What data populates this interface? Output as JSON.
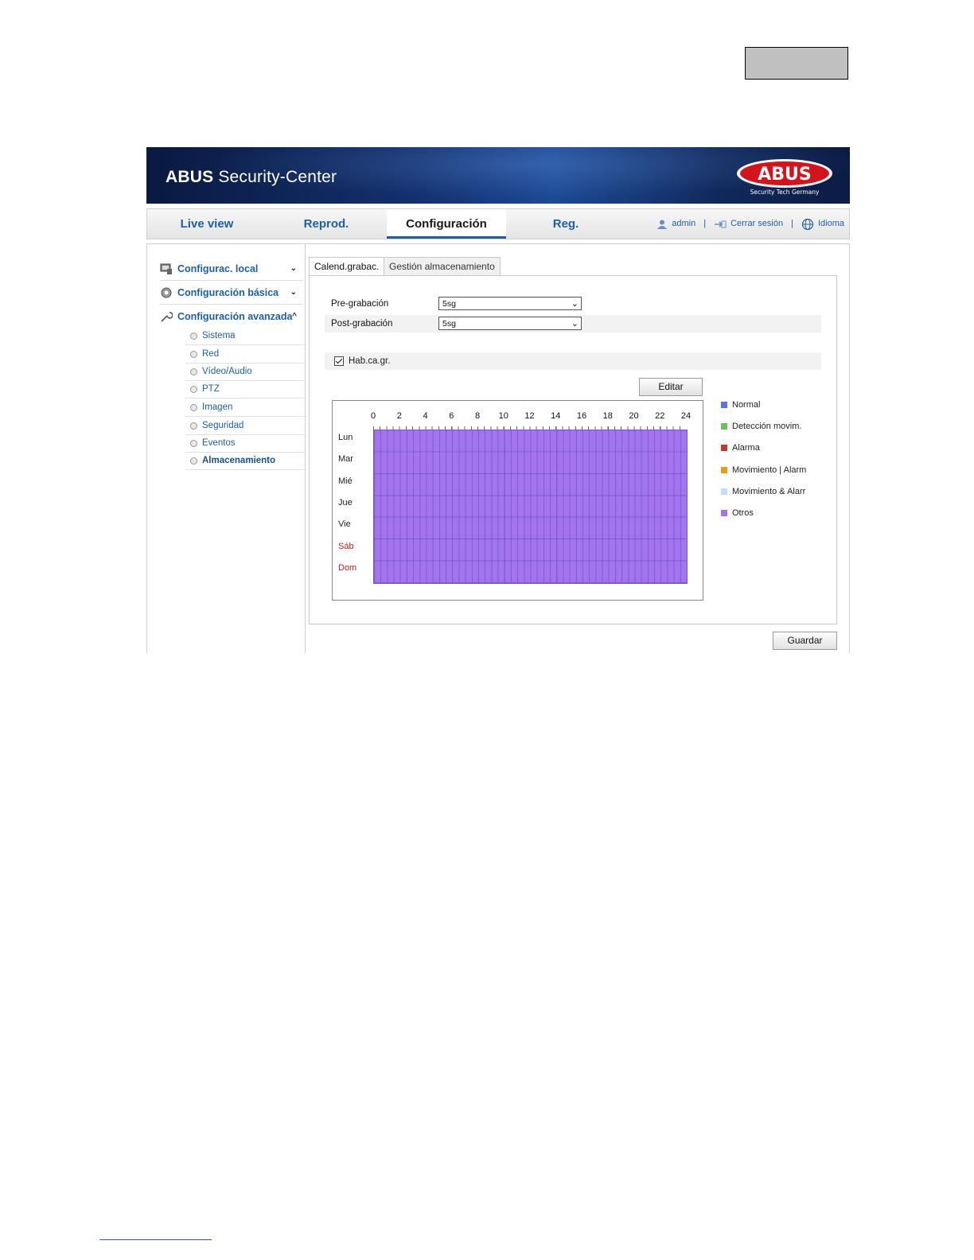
{
  "header": {
    "app_title_bold": "ABUS",
    "app_title_rest": " Security-Center",
    "logo_text": "ABUS",
    "logo_tagline": "Security Tech Germany"
  },
  "topnav": {
    "tabs": [
      {
        "label": "Live view",
        "active": false
      },
      {
        "label": "Reprod.",
        "active": false
      },
      {
        "label": "Configuración",
        "active": true
      },
      {
        "label": "Reg.",
        "active": false
      }
    ],
    "user": "admin",
    "logout": "Cerrar sesión",
    "language": "Idioma"
  },
  "sidebar": {
    "sections": [
      {
        "label": "Configurac. local",
        "icon": "monitor-icon",
        "chevron": "⌄"
      },
      {
        "label": "Configuración básica",
        "icon": "gear-icon",
        "chevron": "⌄"
      },
      {
        "label": "Configuración avanzada",
        "icon": "wrench-icon",
        "chevron": "^"
      }
    ],
    "items": [
      "Sistema",
      "Red",
      "Vídeo/Audio",
      "PTZ",
      "Imagen",
      "Seguridad",
      "Eventos",
      "Almacenamiento"
    ],
    "active_item": "Almacenamiento"
  },
  "subtabs": [
    "Calend.grabac.",
    "Gestión almacenamiento"
  ],
  "form": {
    "pre_label": "Pre-grabación",
    "pre_value": "5sg",
    "post_label": "Post-grabación",
    "post_value": "5sg",
    "enable_label": "Hab.ca.gr.",
    "enable_checked": true
  },
  "buttons": {
    "edit": "Editar",
    "save": "Guardar"
  },
  "schedule": {
    "hours": [
      "0",
      "2",
      "4",
      "6",
      "8",
      "10",
      "12",
      "14",
      "16",
      "18",
      "20",
      "22",
      "24"
    ],
    "days": [
      "Lun",
      "Mar",
      "Mié",
      "Jue",
      "Vie",
      "Sáb",
      "Dom"
    ],
    "fill_type": "Otros",
    "fill_color": "#a374f0"
  },
  "legend": [
    {
      "label": "Normal",
      "color": "#5b73e8"
    },
    {
      "label": "Detección movim.",
      "color": "#6cbf5a"
    },
    {
      "label": "Alarma",
      "color": "#c0392b"
    },
    {
      "label": "Movimiento | Alarm",
      "color": "#e89a1c"
    },
    {
      "label": "Movimiento & Alarr",
      "color": "#bfe0f5"
    },
    {
      "label": "Otros",
      "color": "#a374f0"
    }
  ]
}
